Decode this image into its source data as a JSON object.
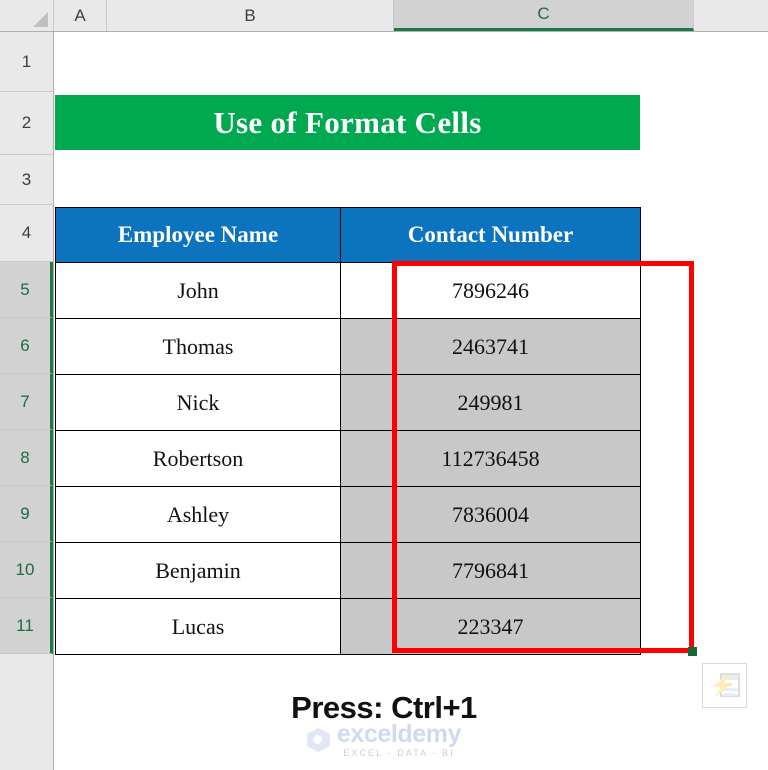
{
  "app": {
    "name": "excel-spreadsheet"
  },
  "grid": {
    "select_all_icon": "select-all-triangle",
    "columns": [
      {
        "label": "A",
        "selected": false
      },
      {
        "label": "B",
        "selected": false
      },
      {
        "label": "C",
        "selected": true
      },
      {
        "label": "",
        "selected": false
      }
    ],
    "rows": [
      {
        "label": "1",
        "selected": false
      },
      {
        "label": "2",
        "selected": false
      },
      {
        "label": "3",
        "selected": false
      },
      {
        "label": "4",
        "selected": false
      },
      {
        "label": "5",
        "selected": true
      },
      {
        "label": "6",
        "selected": true
      },
      {
        "label": "7",
        "selected": true
      },
      {
        "label": "8",
        "selected": true
      },
      {
        "label": "9",
        "selected": true
      },
      {
        "label": "10",
        "selected": true
      },
      {
        "label": "11",
        "selected": true
      }
    ]
  },
  "title_banner": {
    "text": "Use of Format Cells",
    "background": "#00A94F",
    "text_color": "#FFFFFF"
  },
  "table": {
    "headers": [
      "Employee Name",
      "Contact Number"
    ],
    "header_background": "#0C73BE",
    "header_text_color": "#FFFFFF",
    "selected_cell_background": "#C8C8C8",
    "rows": [
      {
        "name": "John",
        "number": "7896246",
        "number_selected": false
      },
      {
        "name": "Thomas",
        "number": "2463741",
        "number_selected": true
      },
      {
        "name": "Nick",
        "number": "249981",
        "number_selected": true
      },
      {
        "name": "Robertson",
        "number": "112736458",
        "number_selected": true
      },
      {
        "name": "Ashley",
        "number": "7836004",
        "number_selected": true
      },
      {
        "name": "Benjamin",
        "number": "7796841",
        "number_selected": true
      },
      {
        "name": "Lucas",
        "number": "223347",
        "number_selected": true
      }
    ]
  },
  "annotation": {
    "highlight_box_color": "#FF0000",
    "press_note": "Press: Ctrl+1"
  },
  "quick_analysis": {
    "icon": "lightning-bolt-quick-analysis-icon"
  },
  "watermark": {
    "name": "exceldemy",
    "tagline": "EXCEL - DATA - BI",
    "logo_icon": "cube-logo-icon"
  }
}
